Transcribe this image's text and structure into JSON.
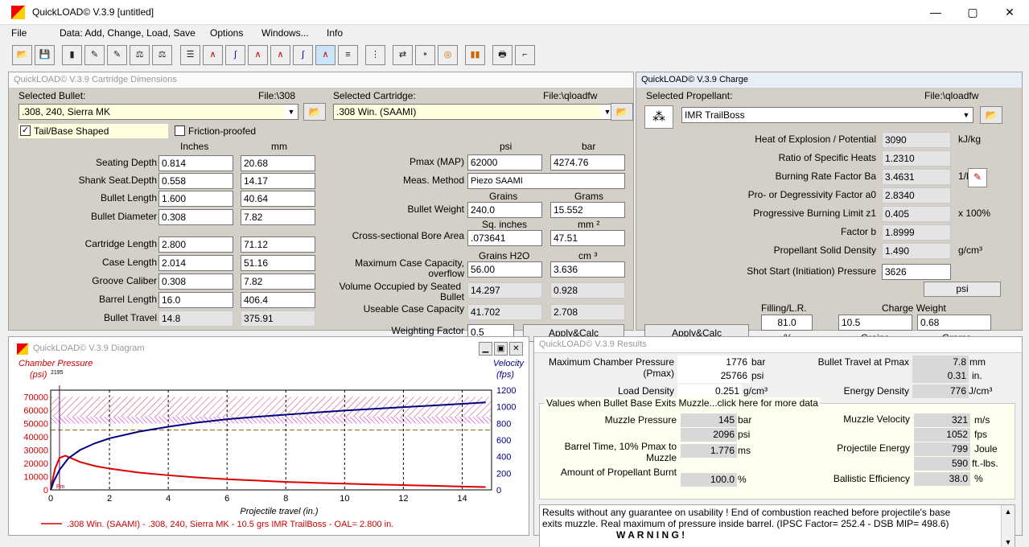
{
  "app": {
    "title": "QuickLOAD© V.3.9   [untitled]",
    "min": "—",
    "max": "▢",
    "close": "✕"
  },
  "menu": [
    "File",
    "Data: Add, Change, Load, Save",
    "Options",
    "Windows...",
    "Info"
  ],
  "dims": {
    "title": "QuickLOAD© V.3.9 Cartridge Dimensions",
    "sel_bullet_label": "Selected Bullet:",
    "bullet_file": "File:\\308",
    "bullet": ".308, 240, Sierra MK",
    "sel_cart_label": "Selected Cartridge:",
    "cart_file": "File:\\qloadfw",
    "cart": ".308 Win. (SAAMI)",
    "tail_label": "Tail/Base Shaped",
    "friction_label": "Friction-proofed",
    "inches": "Inches",
    "mm": "mm",
    "rows": [
      {
        "label": "Seating Depth",
        "in": "0.814",
        "mm": "20.68"
      },
      {
        "label": "Shank Seat.Depth",
        "in": "0.558",
        "mm": "14.17"
      },
      {
        "label": "Bullet Length",
        "in": "1.600",
        "mm": "40.64"
      },
      {
        "label": "Bullet Diameter",
        "in": "0.308",
        "mm": "7.82"
      },
      {
        "label": "Cartridge Length",
        "in": "2.800",
        "mm": "71.12"
      },
      {
        "label": "Case Length",
        "in": "2.014",
        "mm": "51.16"
      },
      {
        "label": "Groove Caliber",
        "in": "0.308",
        "mm": "7.82"
      },
      {
        "label": "Barrel Length",
        "in": "16.0",
        "mm": "406.4"
      },
      {
        "label": "Bullet Travel",
        "in": "14.8",
        "mm": "375.91"
      }
    ],
    "psi": "psi",
    "bar": "bar",
    "pmax_label": "Pmax (MAP)",
    "pmax_psi": "62000",
    "pmax_bar": "4274.76",
    "meas_label": "Meas. Method",
    "meas": "Piezo SAAMI",
    "grains": "Grains",
    "grams": "Grams",
    "bw_label": "Bullet Weight",
    "bw_gr": "240.0",
    "bw_g": "15.552",
    "sqin": "Sq. inches",
    "mm2": "mm ²",
    "bore_label": "Cross-sectional Bore Area",
    "bore_in": ".073641",
    "bore_mm": "47.51",
    "grh2o": "Grains H2O",
    "cm3": "cm ³",
    "maxcap_label1": "Maximum Case Capacity,",
    "maxcap_label2": "overflow",
    "maxcap_gr": "56.00",
    "maxcap_cm": "3.636",
    "vol_label1": "Volume Occupied by Seated",
    "vol_label2": "Bullet",
    "vol_gr": "14.297",
    "vol_cm": "0.928",
    "use_label": "Useable Case Capacity",
    "use_gr": "41.702",
    "use_cm": "2.708",
    "wf_label": "Weighting Factor",
    "wf": "0.5",
    "apply": "Apply&Calc"
  },
  "charge": {
    "title": "QuickLOAD© V.3.9 Charge",
    "sel_label": "Selected Propellant:",
    "file": "File:\\qloadfw",
    "prop": "IMR TrailBoss",
    "rows": [
      {
        "label": "Heat of Explosion / Potential",
        "val": "3090",
        "unit": "kJ/kg"
      },
      {
        "label": "Ratio of Specific Heats",
        "val": "1.2310",
        "unit": ""
      },
      {
        "label": "Burning Rate Factor  Ba",
        "val": "3.4631",
        "unit": "1/bar's"
      },
      {
        "label": "Pro- or Degressivity Factor  a0",
        "val": "2.8340",
        "unit": ""
      },
      {
        "label": "Progressive Burning Limit z1",
        "val": "0.405",
        "unit": "x 100%"
      },
      {
        "label": "Factor  b",
        "val": "1.8999",
        "unit": ""
      },
      {
        "label": "Propellant Solid Density",
        "val": "1.490",
        "unit": "g/cm³"
      },
      {
        "label": "Shot Start (Initiation) Pressure",
        "val": "3626",
        "unit": "psi"
      }
    ],
    "filling_label": "Filling/L.R.",
    "filling": "81.0",
    "pct": "%",
    "cw_label": "Charge Weight",
    "cw_gr": "10.5",
    "cw_g": "0.68",
    "grains": "Grains",
    "grams": "Grams",
    "apply": "Apply&Calc"
  },
  "diagram": {
    "title": "QuickLOAD© V.3.9 Diagram",
    "legend": ".308 Win. (SAAMI) - .308, 240, Sierra MK - 10.5 grs IMR TrailBoss - OAL= 2.800 in.",
    "top_mark": "2195",
    "pm": "Pm"
  },
  "chart_data": {
    "type": "line",
    "title": "",
    "xlabel": "Projectile travel (in.)",
    "ylabel": "Chamber Pressure (psi)",
    "y2label": "Velocity (fps)",
    "xlim": [
      0,
      15
    ],
    "ylim": [
      0,
      75000
    ],
    "y2lim": [
      0,
      1200
    ],
    "xticks": [
      0,
      2,
      4,
      6,
      8,
      10,
      12,
      14
    ],
    "yticks": [
      0,
      10000,
      20000,
      30000,
      40000,
      50000,
      60000,
      70000
    ],
    "y2ticks": [
      0,
      200,
      400,
      600,
      800,
      1000,
      1200
    ],
    "series": [
      {
        "axis": "y",
        "color": "#dd0000",
        "x": [
          0,
          0.05,
          0.15,
          0.3,
          0.5,
          1,
          1.5,
          2,
          3,
          4,
          5,
          6,
          7,
          8,
          9,
          10,
          11,
          12,
          13,
          14,
          14.8
        ],
        "y": [
          0,
          6000,
          16000,
          24000,
          25766,
          21000,
          18000,
          16000,
          13000,
          11000,
          9300,
          8000,
          7000,
          6000,
          5300,
          4700,
          4100,
          3600,
          3100,
          2500,
          2096
        ]
      },
      {
        "axis": "y2",
        "color": "#000080",
        "x": [
          0,
          0.1,
          0.3,
          0.6,
          1,
          1.5,
          2,
          3,
          4,
          5,
          6,
          7,
          8,
          9,
          10,
          11,
          12,
          13,
          14,
          14.8
        ],
        "y": [
          0,
          100,
          240,
          380,
          480,
          560,
          620,
          700,
          760,
          810,
          850,
          880,
          905,
          930,
          955,
          975,
          995,
          1015,
          1035,
          1052
        ]
      }
    ],
    "bands": [
      {
        "from": 55000,
        "to": 70000,
        "color": "#cc3366"
      },
      {
        "from": 50000,
        "to": 55000,
        "color": "#cc00cc"
      }
    ]
  },
  "results": {
    "title": "QuickLOAD© V.3.9 Results",
    "mcp_label1": "Maximum Chamber Pressure",
    "mcp_label2": "(Pmax)",
    "mcp_bar": "1776",
    "mcp_bar_u": "bar",
    "mcp_psi": "25766",
    "mcp_psi_u": "psi",
    "bt_label": "Bullet Travel at Pmax",
    "bt_mm": "7.8",
    "bt_mm_u": "mm",
    "bt_in": "0.31",
    "bt_in_u": "in.",
    "ld_label": "Load Density",
    "ld": "0.251",
    "ld_u": "g/cm³",
    "ed_label": "Energy Density",
    "ed": "776",
    "ed_u": "J/cm³",
    "muzzle_header": "Values when Bullet Base Exits Muzzle...click here for more data",
    "mp_label": "Muzzle Pressure",
    "mp_bar": "145",
    "mp_bar_u": "bar",
    "mp_psi": "2096",
    "mp_psi_u": "psi",
    "mv_label": "Muzzle Velocity",
    "mv_ms": "321",
    "mv_ms_u": "m/s",
    "mv_fps": "1052",
    "mv_fps_u": "fps",
    "bt2_label1": "Barrel Time, 10% Pmax to",
    "bt2_label2": "Muzzle",
    "bt2": "1.776",
    "bt2_u": "ms",
    "pe_label": "Projectile Energy",
    "pe_j": "799",
    "pe_j_u": "Joule",
    "pe_ft": "590",
    "pe_ft_u": "ft.-lbs.",
    "pb_label": "Amount of Propellant Burnt",
    "pb": "100.0",
    "pb_u": "%",
    "be_label": "Ballistic Efficiency",
    "be": "38.0",
    "be_u": "%",
    "msg1": "Results without any guarantee on usability !  End of combustion reached before projectile's base",
    "msg2": "exits muzzle.  Real maximum of pressure inside barrel.  (IPSC Factor= 252.4 - DSB MIP= 498.6)",
    "msg3": "W A R N I N G !"
  }
}
